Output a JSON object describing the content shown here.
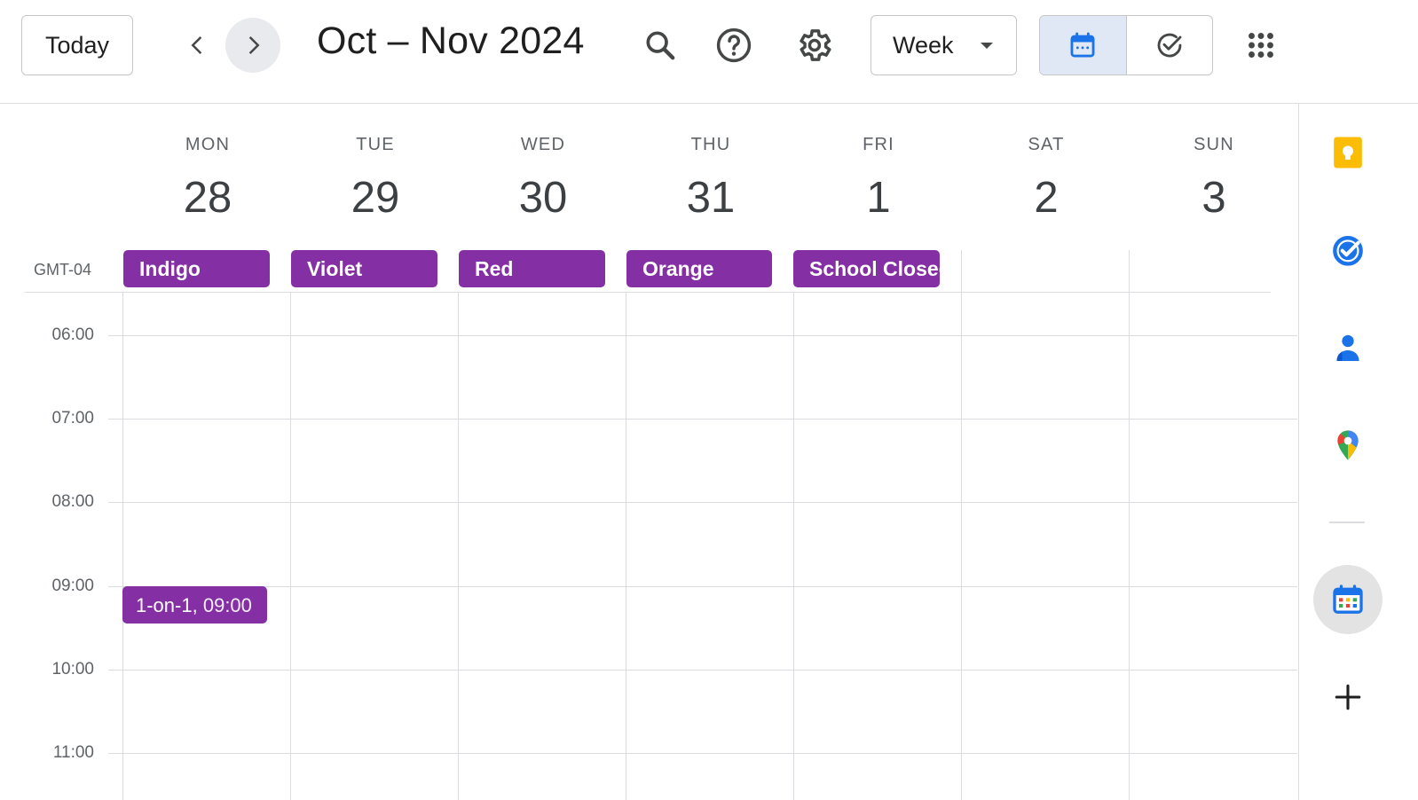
{
  "header": {
    "today_label": "Today",
    "date_range_title": "Oct – Nov 2024",
    "view_selector_value": "Week",
    "icons": {
      "prev": "chevron-left-icon",
      "next": "chevron-right-icon",
      "search": "search-icon",
      "help": "help-icon",
      "settings": "gear-icon",
      "calendar_view": "calendar-icon",
      "tasks_view": "tasks-check-icon",
      "apps": "apps-grid-icon"
    }
  },
  "week": {
    "timezone": "GMT-04",
    "days": [
      {
        "dow": "MON",
        "num": "28",
        "allday": "Indigo"
      },
      {
        "dow": "TUE",
        "num": "29",
        "allday": "Violet"
      },
      {
        "dow": "WED",
        "num": "30",
        "allday": "Red"
      },
      {
        "dow": "THU",
        "num": "31",
        "allday": "Orange"
      },
      {
        "dow": "FRI",
        "num": "1",
        "allday": "School Closed"
      },
      {
        "dow": "SAT",
        "num": "2",
        "allday": ""
      },
      {
        "dow": "SUN",
        "num": "3",
        "allday": ""
      }
    ],
    "hours": [
      "06:00",
      "07:00",
      "08:00",
      "09:00",
      "10:00",
      "11:00"
    ],
    "events": [
      {
        "title": "1-on-1,",
        "time": "09:00"
      }
    ]
  },
  "side_panel": {
    "icons": [
      "keep-icon",
      "tasks-icon",
      "contacts-icon",
      "maps-icon",
      "calendar-addon-icon",
      "add-icon"
    ]
  },
  "colors": {
    "event": "#8430a4",
    "accent_blue": "#1a73e8",
    "active_toggle": "#e1e8f5"
  }
}
